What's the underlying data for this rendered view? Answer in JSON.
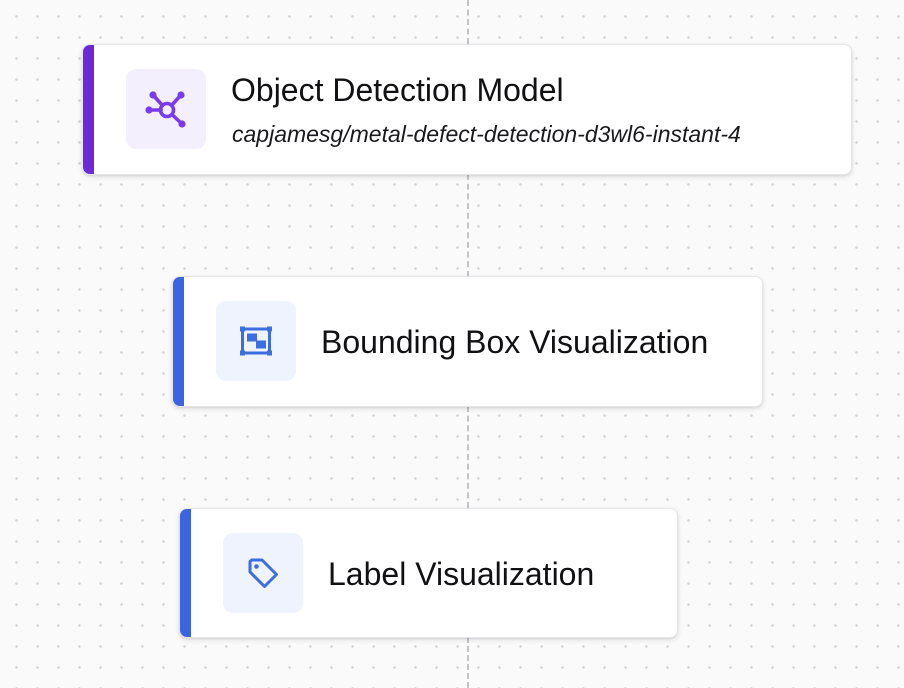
{
  "canvas": {
    "background": "#fafafa",
    "dot_color": "#d6d6da"
  },
  "nodes": [
    {
      "title": "Object Detection Model",
      "subtitle": "capjamesg/metal-defect-detection-d3wl6-instant-4",
      "icon": "model-network-icon",
      "accent_color": "#6d28d9",
      "icon_bg": "#f3effd",
      "icon_color": "#7c3aed"
    },
    {
      "title": "Bounding Box Visualization",
      "icon": "bounding-box-icon",
      "accent_color": "#3b64e0",
      "icon_bg": "#eef3fd",
      "icon_color": "#3d6ee0"
    },
    {
      "title": "Label Visualization",
      "icon": "tag-icon",
      "accent_color": "#3b64e0",
      "icon_bg": "#eef3fd",
      "icon_color": "#3d6ee0"
    }
  ]
}
